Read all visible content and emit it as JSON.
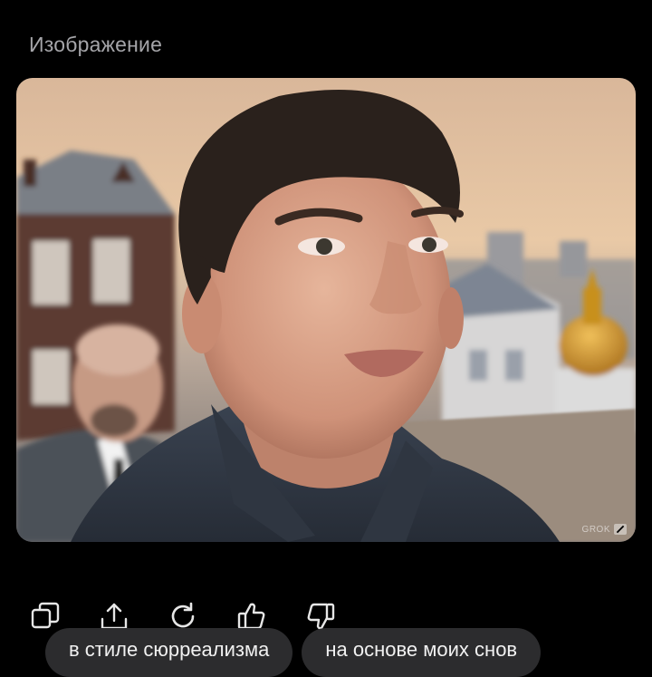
{
  "header": {
    "title": "Изображение"
  },
  "image": {
    "watermark": "GROK"
  },
  "actions": [
    {
      "icon": "copy-icon"
    },
    {
      "icon": "share-icon"
    },
    {
      "icon": "regenerate-icon"
    },
    {
      "icon": "thumbs-up-icon"
    },
    {
      "icon": "thumbs-down-icon"
    }
  ],
  "suggestions": [
    "в стиле сюрреализма",
    "на основе моих снов"
  ],
  "colors": {
    "background": "#000000",
    "title": "#a5a5a9",
    "chip_bg": "#2c2c2e"
  }
}
